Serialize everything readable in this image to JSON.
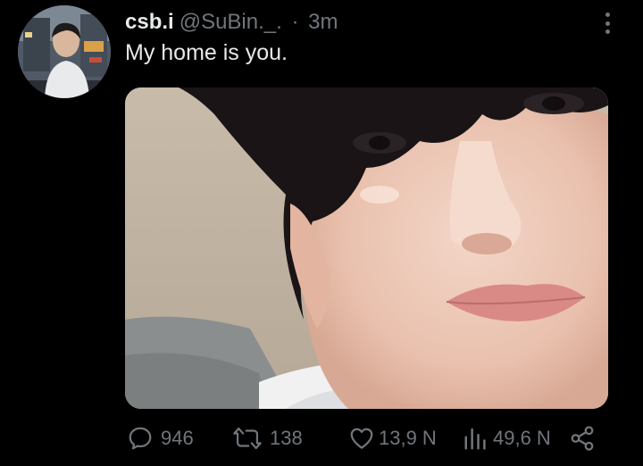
{
  "tweet": {
    "author": {
      "display_name": "csb.i",
      "handle": "@SuBin._.",
      "avatar": "profile-photo"
    },
    "separator": "·",
    "time": "3m",
    "text": "My home is you.",
    "media": {
      "kind": "photo",
      "description_icon": "selfie-photo"
    },
    "actions": {
      "reply": {
        "icon": "reply-icon",
        "count": "946"
      },
      "retweet": {
        "icon": "retweet-icon",
        "count": "138"
      },
      "like": {
        "icon": "heart-icon",
        "count": "13,9 N"
      },
      "views": {
        "icon": "views-icon",
        "count": "49,6 N"
      },
      "share": {
        "icon": "share-icon"
      }
    },
    "more_menu": {
      "icon": "more-vertical-icon"
    }
  },
  "colors": {
    "background": "#000000",
    "primary_text": "#e7e9ea",
    "secondary_text": "#71767b"
  }
}
